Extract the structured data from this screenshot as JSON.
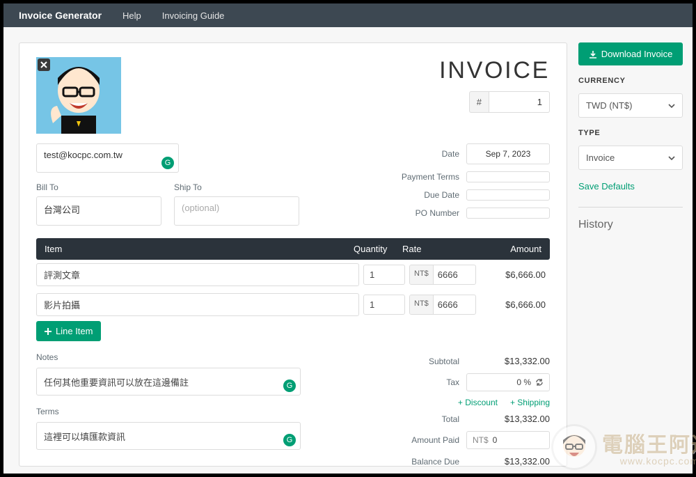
{
  "nav": {
    "brand": "Invoice Generator",
    "help": "Help",
    "guide": "Invoicing Guide"
  },
  "sidebar": {
    "download": "Download Invoice",
    "currency_label": "CURRENCY",
    "currency_value": "TWD (NT$)",
    "type_label": "TYPE",
    "type_value": "Invoice",
    "save_defaults": "Save Defaults",
    "history": "History"
  },
  "invoice": {
    "title": "INVOICE",
    "hash": "#",
    "number": "1",
    "from_email": "test@kocpc.com.tw",
    "bill_to_label": "Bill To",
    "bill_to_value": "台灣公司",
    "ship_to_label": "Ship To",
    "ship_to_placeholder": "(optional)",
    "date_label": "Date",
    "date_value": "Sep 7, 2023",
    "payment_terms_label": "Payment Terms",
    "payment_terms_value": "",
    "due_date_label": "Due Date",
    "due_date_value": "",
    "po_label": "PO Number",
    "po_value": ""
  },
  "columns": {
    "item": "Item",
    "quantity": "Quantity",
    "rate": "Rate",
    "amount": "Amount"
  },
  "currency_prefix": "NT$",
  "items": [
    {
      "name": "評測文章",
      "qty": "1",
      "rate": "6666",
      "amount": "$6,666.00"
    },
    {
      "name": "影片拍攝",
      "qty": "1",
      "rate": "6666",
      "amount": "$6,666.00"
    }
  ],
  "add_line": "Line Item",
  "notes": {
    "notes_label": "Notes",
    "notes_value": "任何其他重要資訊可以放在這邊備註",
    "terms_label": "Terms",
    "terms_value": "這裡可以填匯款資訊"
  },
  "totals": {
    "subtotal_label": "Subtotal",
    "subtotal_value": "$13,332.00",
    "tax_label": "Tax",
    "tax_value": "0 %",
    "discount_link": "+ Discount",
    "shipping_link": "+ Shipping",
    "total_label": "Total",
    "total_value": "$13,332.00",
    "amount_paid_label": "Amount Paid",
    "amount_paid_prefix": "NT$",
    "amount_paid_value": "0",
    "balance_due_label": "Balance Due",
    "balance_due_value": "$13,332.00"
  },
  "watermark": {
    "cn": "電腦王阿達",
    "url": "www.kocpc.com.tw"
  }
}
